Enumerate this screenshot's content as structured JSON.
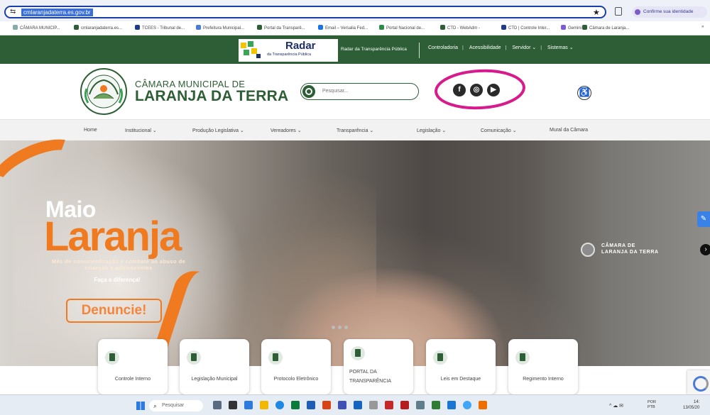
{
  "browser": {
    "url": "cmlaranjadaterra.es.gov.br",
    "identity_label": "Confirme sua identidade",
    "bookmarks": [
      "CÂMARA MUNICIP...",
      "cmlaranjadaterra.es...",
      "TCEES - Tribunal de...",
      "Prefeitura Municipal...",
      "Portal da Transparê...",
      "Email – Versalia Fed...",
      "Portal Nacional de...",
      "CTD - WebAdm -",
      "CTD | Controle Inter...",
      "Gemini",
      "Câmara de Laranja..."
    ],
    "more_bookmarks": "»"
  },
  "topbar": {
    "radar_title": "Radar",
    "radar_subtitle": "da Transparência Pública",
    "radar_caption": "Radar da Transparência Pública",
    "links": [
      "Controladoria",
      "Acessibilidade",
      "Servidor ⌄",
      "Sistemas ⌄"
    ],
    "separator": "|"
  },
  "header": {
    "brand_line1": "CÂMARA MUNICIPAL DE",
    "brand_line2": "LARANJA DA TERRA",
    "search_placeholder": "Pesquisar...",
    "social": {
      "facebook": "f",
      "instagram": "◎",
      "youtube": "▶"
    },
    "accessibility": "♿"
  },
  "nav": {
    "items": [
      "Home",
      "Institucional ⌄",
      "Produção Legislativa ⌄",
      "Vereadores ⌄",
      "Transparência ⌄",
      "Legislação ⌄",
      "Comunicação ⌄",
      "Mural da Câmara"
    ]
  },
  "hero": {
    "title_word1": "Maio",
    "title_word2": "Laranja",
    "tagline": "Mês de conscientização e combate ao abuso de crianças e adolescentes",
    "cta_line": "Faça a diferença!",
    "button": "Denuncie!",
    "logo_line1": "CÂMARA DE",
    "logo_line2": "LARANJA DA TERRA",
    "next_arrow": "›",
    "side_tab": "✎"
  },
  "cards": [
    {
      "label": "Controle Interno"
    },
    {
      "label": "Legislação Municipal"
    },
    {
      "label": "Protocolo Eletrônico"
    },
    {
      "label": "PORTAL DA TRANSPARÊNCIA"
    },
    {
      "label": "Leis em Destaque"
    },
    {
      "label": "Regimento Interno"
    }
  ],
  "taskbar": {
    "search_label": "Pesquisar",
    "tray": "^ ☁ ✉",
    "lang_top": "POR",
    "lang_bottom": "PTB",
    "time": "14:",
    "date": "13/05/20"
  },
  "colors": {
    "brand_green": "#2d5e35",
    "orange": "#f07a1f",
    "highlight_circle": "#d81b8c"
  }
}
